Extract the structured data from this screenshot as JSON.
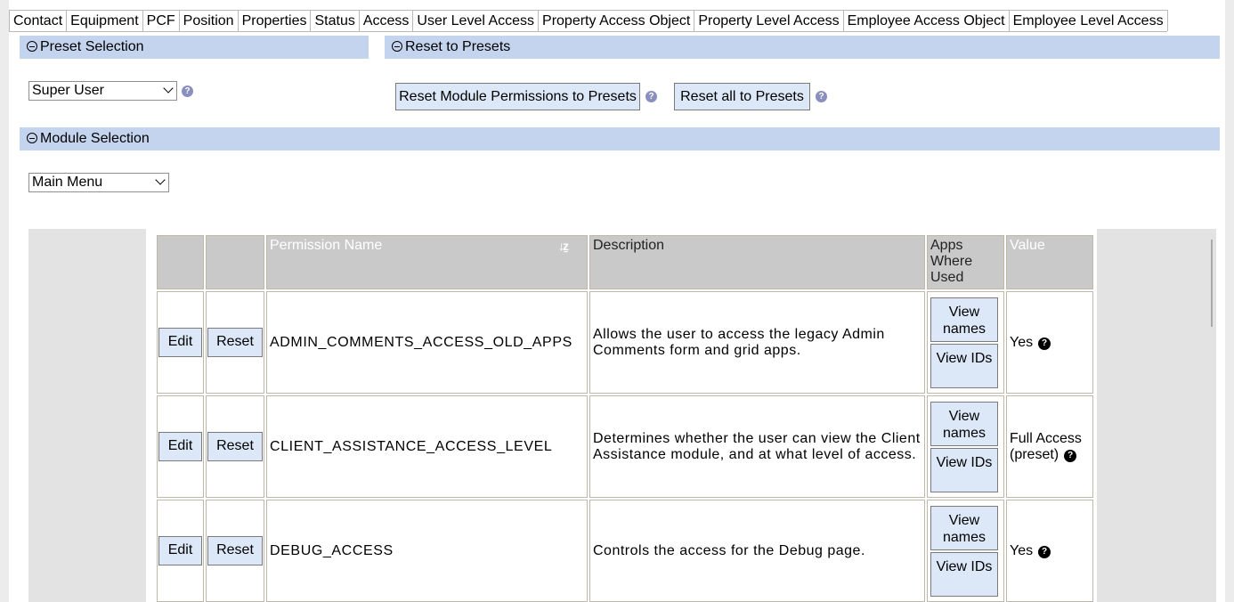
{
  "tabs": [
    {
      "label": "Contact"
    },
    {
      "label": "Equipment"
    },
    {
      "label": "PCF"
    },
    {
      "label": "Position"
    },
    {
      "label": "Properties"
    },
    {
      "label": "Status"
    },
    {
      "label": "Access"
    },
    {
      "label": "User Level Access",
      "active": true
    },
    {
      "label": "Property Access Object"
    },
    {
      "label": "Property Level Access"
    },
    {
      "label": "Employee Access Object"
    },
    {
      "label": "Employee Level Access"
    }
  ],
  "preset_section": {
    "title": "Preset Selection",
    "selected": "Super User"
  },
  "reset_section": {
    "title": "Reset to Presets",
    "reset_module_label": "Reset Module Permissions to Presets",
    "reset_all_label": "Reset all to Presets"
  },
  "module_section": {
    "title": "Module Selection",
    "selected": "Main Menu"
  },
  "help_glyph": "?",
  "grid": {
    "headers": {
      "permission_name": "Permission Name",
      "description": "Description",
      "apps_where_used": "Apps Where Used",
      "value": "Value"
    },
    "edit_label": "Edit",
    "reset_label": "Reset",
    "view_names_label": "View names",
    "view_ids_label": "View IDs",
    "rows": [
      {
        "name": "ADMIN_COMMENTS_ACCESS_OLD_APPS",
        "description": "Allows the user to access the legacy Admin Comments form and grid apps.",
        "value": "Yes"
      },
      {
        "name": "CLIENT_ASSISTANCE_ACCESS_LEVEL",
        "description": "Determines whether the user can view the Client Assistance module, and at what level of access.",
        "value": "Full Access (preset)"
      },
      {
        "name": "DEBUG_ACCESS",
        "description": "Controls the access for the Debug page.",
        "value": "Yes"
      }
    ]
  }
}
